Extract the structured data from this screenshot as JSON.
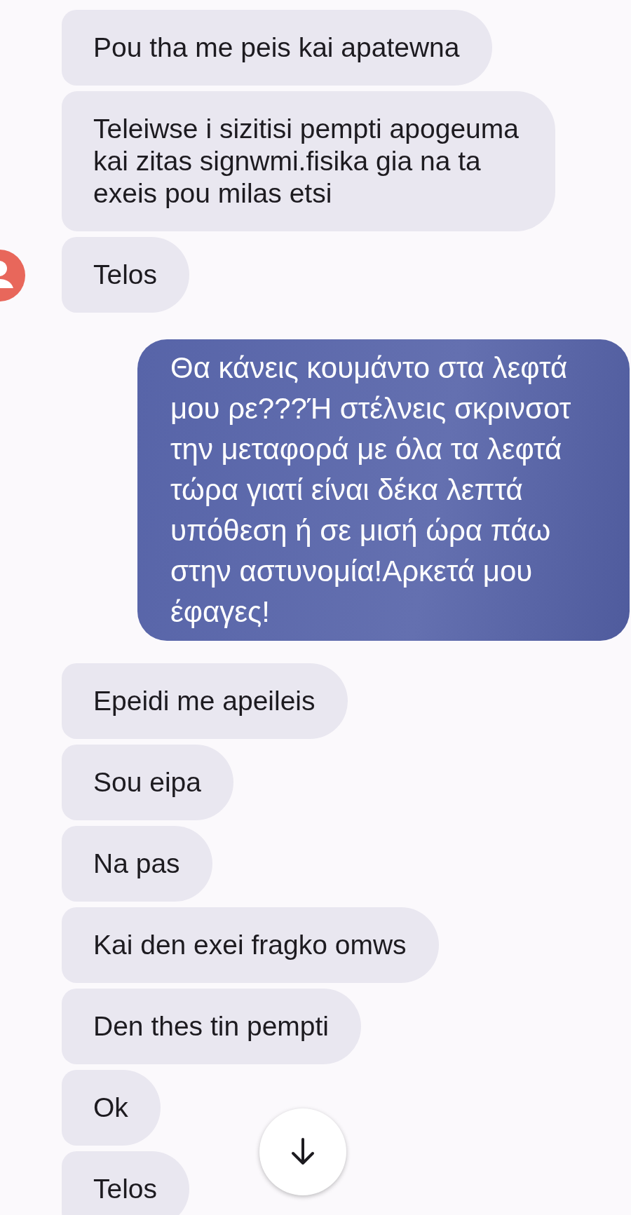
{
  "messages": [
    {
      "kind": "incoming",
      "text": "Pou tha me peis kai apatewna",
      "avatar": false
    },
    {
      "kind": "incoming",
      "text": "Teleiwse i sizitisi pempti apogeuma kai zitas signwmi.fisika gia na ta exeis pou milas etsi",
      "avatar": false
    },
    {
      "kind": "incoming",
      "text": "Telos",
      "avatar": true
    },
    {
      "kind": "outgoing",
      "text": "Θα κάνεις κουμάντο στα λεφτά μου ρε???Ή στέλνεις σκρινσοτ την μεταφορά με όλα τα λεφτά τώρα γιατί είναι δέκα λεπτά υπόθεση ή σε μισή ώρα πάω στην αστυνομία!Αρκετά μου έφαγες!",
      "avatar": false
    },
    {
      "kind": "incoming",
      "text": "Epeidi me apeileis",
      "avatar": false
    },
    {
      "kind": "incoming",
      "text": "Sou eipa",
      "avatar": false
    },
    {
      "kind": "incoming",
      "text": "Na pas",
      "avatar": false
    },
    {
      "kind": "incoming",
      "text": "Kai den exei fragko omws",
      "avatar": false
    },
    {
      "kind": "incoming",
      "text": "Den thes tin pempti",
      "avatar": false
    },
    {
      "kind": "incoming",
      "text": "Ok",
      "avatar": false
    },
    {
      "kind": "incoming",
      "text": "Telos",
      "avatar": false
    }
  ],
  "scroll_down_button": {
    "shown": true
  }
}
